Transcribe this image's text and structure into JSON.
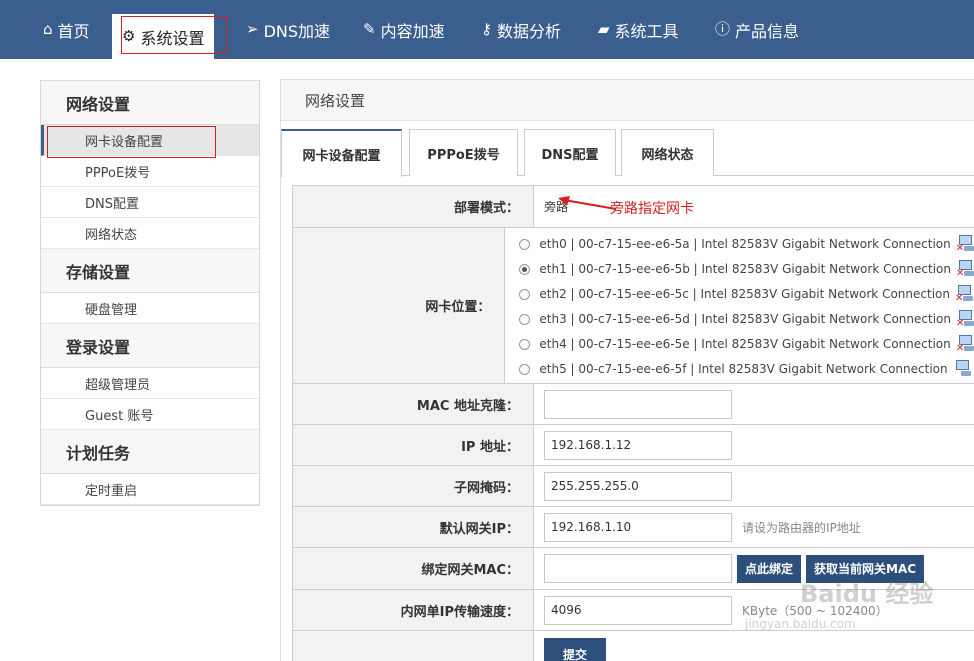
{
  "nav": {
    "items": [
      {
        "icon": "home-icon",
        "glyph": "⌂",
        "label": "首页"
      },
      {
        "icon": "gears-icon",
        "glyph": "⚙",
        "label": "系统设置"
      },
      {
        "icon": "paper-plane-icon",
        "glyph": "➢",
        "label": "DNS加速"
      },
      {
        "icon": "edit-icon",
        "glyph": "✎",
        "label": "内容加速"
      },
      {
        "icon": "user-key-icon",
        "glyph": "⚷",
        "label": "数据分析"
      },
      {
        "icon": "toolbox-icon",
        "glyph": "▰",
        "label": "系统工具"
      },
      {
        "icon": "info-icon",
        "glyph": "ⓘ",
        "label": "产品信息"
      }
    ]
  },
  "sidebar": {
    "groups": [
      {
        "title": "网络设置",
        "items": [
          "网卡设备配置",
          "PPPoE拨号",
          "DNS配置",
          "网络状态"
        ]
      },
      {
        "title": "存储设置",
        "items": [
          "硬盘管理"
        ]
      },
      {
        "title": "登录设置",
        "items": [
          "超级管理员",
          "Guest 账号"
        ]
      },
      {
        "title": "计划任务",
        "items": [
          "定时重启"
        ]
      }
    ]
  },
  "panel": {
    "title": "网络设置",
    "tabs": [
      "网卡设备配置",
      "PPPoE拨号",
      "DNS配置",
      "网络状态"
    ]
  },
  "form": {
    "deploy_mode": {
      "label": "部署模式：",
      "value": "旁路",
      "annotation": "旁路指定网卡"
    },
    "nic_position": {
      "label": "网卡位置：",
      "options": [
        "eth0 | 00-c7-15-ee-e6-5a | Intel 82583V Gigabit Network Connection",
        "eth1 | 00-c7-15-ee-e6-5b | Intel 82583V Gigabit Network Connection",
        "eth2 | 00-c7-15-ee-e6-5c | Intel 82583V Gigabit Network Connection",
        "eth3 | 00-c7-15-ee-e6-5d | Intel 82583V Gigabit Network Connection",
        "eth4 | 00-c7-15-ee-e6-5e | Intel 82583V Gigabit Network Connection",
        "eth5 | 00-c7-15-ee-e6-5f | Intel 82583V Gigabit Network Connection"
      ],
      "selected": "eth1 | 00-c7-15-ee-e6-5b | Intel 82583V Gigabit Network Connection"
    },
    "mac_clone": {
      "label": "MAC 地址克隆：",
      "value": ""
    },
    "ip": {
      "label": "IP 地址：",
      "value": "192.168.1.12"
    },
    "netmask": {
      "label": "子网掩码：",
      "value": "255.255.255.0"
    },
    "gateway": {
      "label": "默认网关IP：",
      "value": "192.168.1.10",
      "hint": "请设为路由器的IP地址"
    },
    "bind_mac": {
      "label": "绑定网关MAC：",
      "value": "",
      "bind_button": "点此绑定",
      "fetch_button": "获取当前网关MAC"
    },
    "lan_speed": {
      "label": "内网单IP传输速度：",
      "value": "4096",
      "hint": "KByte（500 ~ 102400）"
    },
    "submit_label": "提交"
  },
  "watermark": {
    "text": "Baidu 经验",
    "sub": "jingyan.baidu.com"
  }
}
